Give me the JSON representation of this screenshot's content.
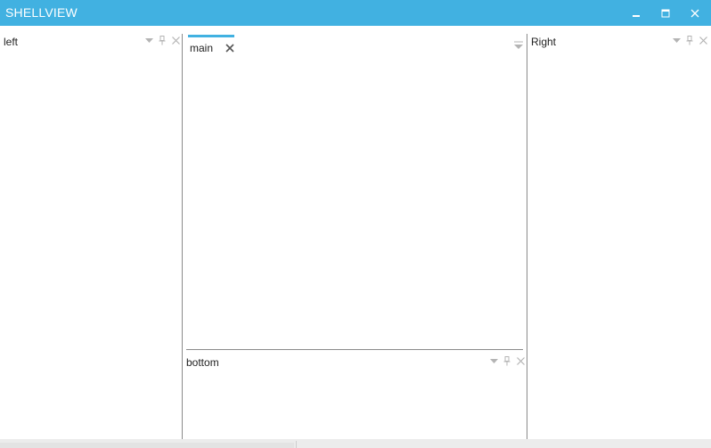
{
  "window": {
    "title": "SHELLVIEW",
    "accent_color": "#41b1e1",
    "controls": {
      "minimize_icon": "minimize-icon",
      "maximize_icon": "maximize-icon",
      "close_icon": "close-icon"
    }
  },
  "panes": {
    "left": {
      "title": "left",
      "actions": [
        "dropdown-icon",
        "pin-icon",
        "close-icon"
      ]
    },
    "main": {
      "tabs": [
        {
          "label": "main",
          "active": true,
          "close_icon": "close-icon"
        }
      ],
      "tab_menu_icon": "tab-list-icon"
    },
    "bottom": {
      "title": "bottom",
      "actions": [
        "dropdown-icon",
        "pin-icon",
        "close-icon"
      ]
    },
    "right": {
      "title": "Right",
      "actions": [
        "dropdown-icon",
        "pin-icon",
        "close-icon"
      ]
    }
  }
}
